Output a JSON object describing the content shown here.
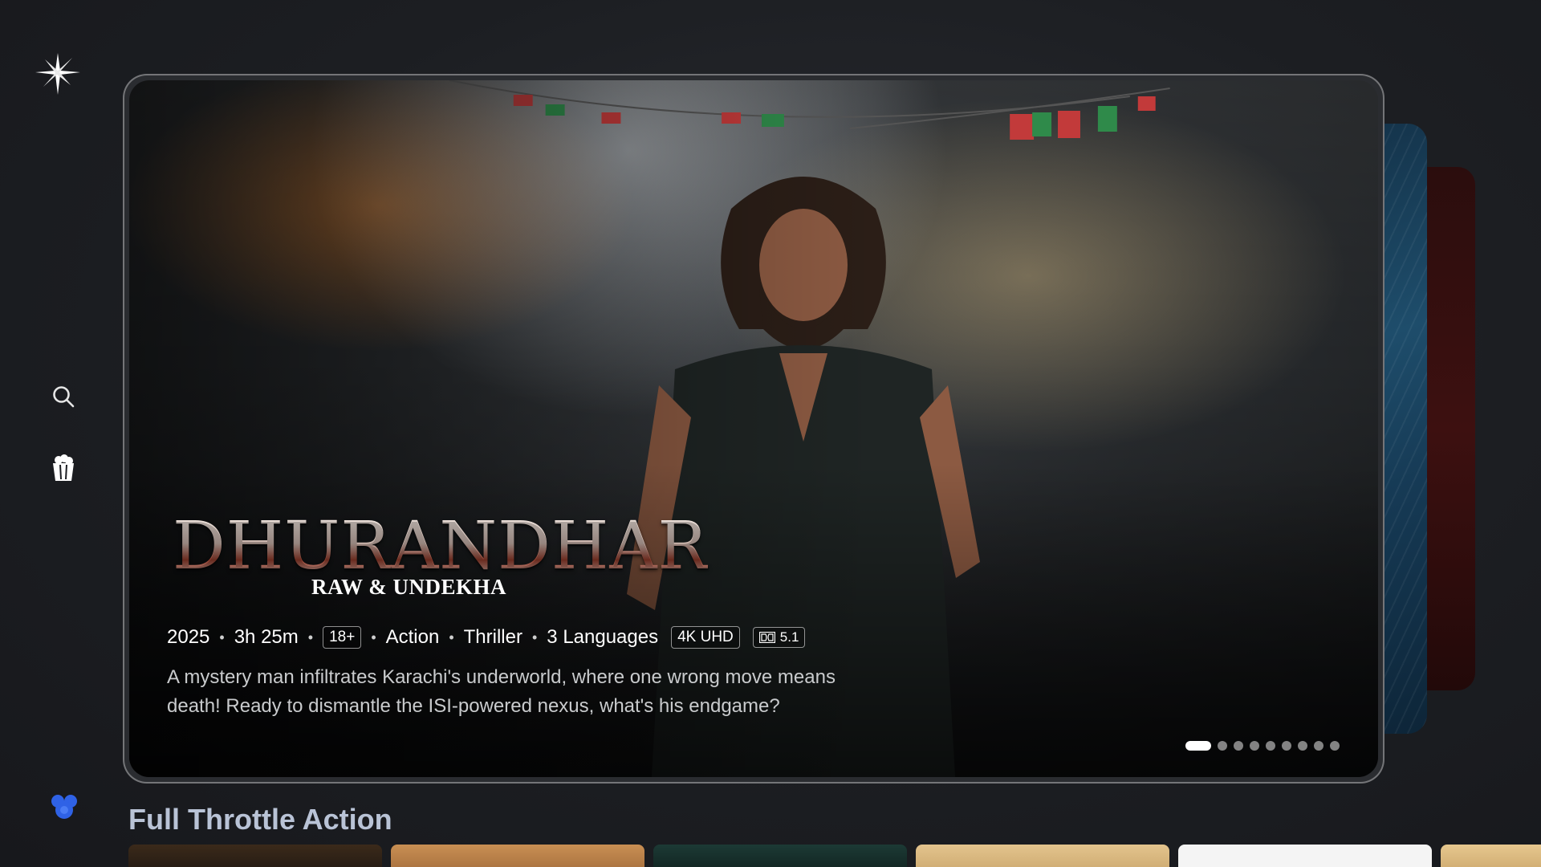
{
  "sidebar": {
    "logo_icon": "sparkle-star-icon",
    "items": [
      {
        "icon": "search-icon",
        "name": "Search"
      },
      {
        "icon": "popcorn-icon",
        "name": "Movies"
      }
    ],
    "profile_icon": "profile-avatar-icon"
  },
  "hero": {
    "title": "DHURANDHAR",
    "subtitle": "RAW & UNDEKHA",
    "year": "2025",
    "duration": "3h 25m",
    "rating": "18+",
    "genres": [
      "Action",
      "Thriller"
    ],
    "languages": "3 Languages",
    "resolution": "4K UHD",
    "audio": "5.1",
    "synopsis": "A mystery man infiltrates Karachi's underworld, where one wrong move means death! Ready to dismantle the ISI-powered nexus, what's his endgame?",
    "pager": {
      "total": 9,
      "active": 1
    }
  },
  "row": {
    "title": "Full Throttle Action"
  },
  "colors": {
    "background": "#1b1d22",
    "row_title": "#b9c3d6",
    "profile_blue": "#2f62e6"
  }
}
